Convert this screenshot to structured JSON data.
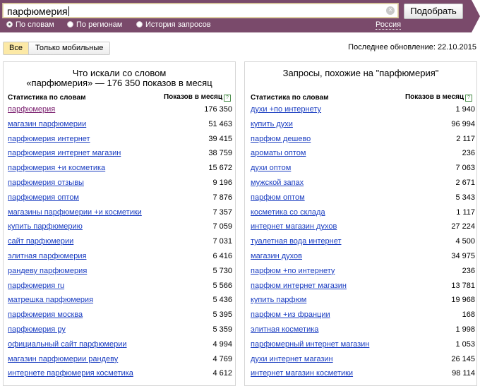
{
  "search": {
    "value": "парфюмерия",
    "clear_symbol": "×",
    "submit_label": "Подобрать"
  },
  "modes": [
    {
      "label": "По словам",
      "selected": true
    },
    {
      "label": "По регионам",
      "selected": false
    },
    {
      "label": "История запросов",
      "selected": false
    }
  ],
  "region": "Россия",
  "filter": {
    "all_label": "Все",
    "mobile_label": "Только мобильные"
  },
  "updated": "Последнее обновление: 22.10.2015",
  "left": {
    "title_line1": "Что искали со словом",
    "title_line2": "«парфюмерия» — 176 350 показов в месяц",
    "col_keyword": "Статистика по словам",
    "col_count": "Показов в месяц",
    "help": "?",
    "rows": [
      {
        "kw": "парфюмерия",
        "n": "176 350"
      },
      {
        "kw": "магазин парфюмерии",
        "n": "51 463"
      },
      {
        "kw": "парфюмерия интернет",
        "n": "39 415"
      },
      {
        "kw": "парфюмерия интернет магазин",
        "n": "38 759"
      },
      {
        "kw": "парфюмерия +и косметика",
        "n": "15 672"
      },
      {
        "kw": "парфюмерия отзывы",
        "n": "9 196"
      },
      {
        "kw": "парфюмерия оптом",
        "n": "7 876"
      },
      {
        "kw": "магазины парфюмерии +и косметики",
        "n": "7 357"
      },
      {
        "kw": "купить парфюмерию",
        "n": "7 059"
      },
      {
        "kw": "сайт парфюмерии",
        "n": "7 031"
      },
      {
        "kw": "элитная парфюмерия",
        "n": "6 416"
      },
      {
        "kw": "рандеву парфюмерия",
        "n": "5 730"
      },
      {
        "kw": "парфюмерия ru",
        "n": "5 566"
      },
      {
        "kw": "матрешка парфюмерия",
        "n": "5 436"
      },
      {
        "kw": "парфюмерия москва",
        "n": "5 395"
      },
      {
        "kw": "парфюмерия ру",
        "n": "5 359"
      },
      {
        "kw": "официальный сайт парфюмерии",
        "n": "4 994"
      },
      {
        "kw": "магазин парфюмерии рандеву",
        "n": "4 769"
      },
      {
        "kw": "интернете парфюмерия косметика",
        "n": "4 612"
      }
    ]
  },
  "right": {
    "title": "Запросы, похожие на \"парфюмерия\"",
    "col_keyword": "Статистика по словам",
    "col_count": "Показов в месяц",
    "help": "?",
    "rows": [
      {
        "kw": "духи +по интернету",
        "n": "1 940"
      },
      {
        "kw": "купить духи",
        "n": "96 994"
      },
      {
        "kw": "парфюм дешево",
        "n": "2 117"
      },
      {
        "kw": "ароматы оптом",
        "n": "236"
      },
      {
        "kw": "духи оптом",
        "n": "7 063"
      },
      {
        "kw": "мужской запах",
        "n": "2 671"
      },
      {
        "kw": "парфюм оптом",
        "n": "5 343"
      },
      {
        "kw": "косметика со склада",
        "n": "1 117"
      },
      {
        "kw": "интернет магазин духов",
        "n": "27 224"
      },
      {
        "kw": "туалетная вода интернет",
        "n": "4 500"
      },
      {
        "kw": "магазин духов",
        "n": "34 975"
      },
      {
        "kw": "парфюм +по интернету",
        "n": "236"
      },
      {
        "kw": "парфюм интернет магазин",
        "n": "13 781"
      },
      {
        "kw": "купить парфюм",
        "n": "19 968"
      },
      {
        "kw": "парфюм +из франции",
        "n": "168"
      },
      {
        "kw": "элитная косметика",
        "n": "1 998"
      },
      {
        "kw": "парфюмерный интернет магазин",
        "n": "1 053"
      },
      {
        "kw": "духи интернет магазин",
        "n": "26 145"
      },
      {
        "kw": "интернет магазин косметики",
        "n": "98 114"
      }
    ]
  }
}
